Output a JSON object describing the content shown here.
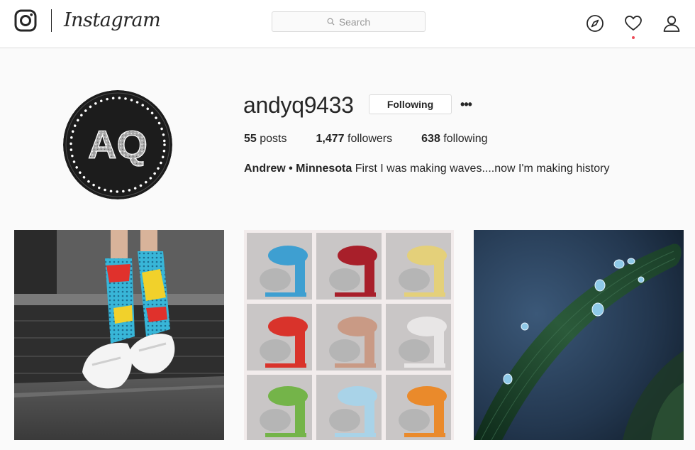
{
  "app": {
    "logo_icon": "instagram-camera-icon",
    "wordmark": "Instagram"
  },
  "search": {
    "placeholder": "Search",
    "icon": "search-icon"
  },
  "nav": {
    "icons": [
      "explore-compass-icon",
      "heart-icon",
      "profile-icon"
    ],
    "notification_dot_color": "#ed4956"
  },
  "profile": {
    "username": "andyq9433",
    "follow_button_label": "Following",
    "more_options_label": "•••",
    "avatar_initials": "AQ",
    "stats": {
      "posts_count": "55",
      "posts_label": "posts",
      "followers_count": "1,477",
      "followers_label": "followers",
      "following_count": "638",
      "following_label": "following"
    },
    "bio": {
      "name": "Andrew • Minnesota",
      "text": "First I was making waves....now I'm making history"
    }
  },
  "posts": [
    {
      "subject": "pop-art socks and white sneakers photo"
    },
    {
      "subject": "colorful stand mixers in shelf grid photo"
    },
    {
      "subject": "leaf with water droplets photo"
    }
  ],
  "colors": {
    "border": "#dbdbdb",
    "text": "#262626",
    "background": "#fafafa",
    "muted": "#999999"
  }
}
